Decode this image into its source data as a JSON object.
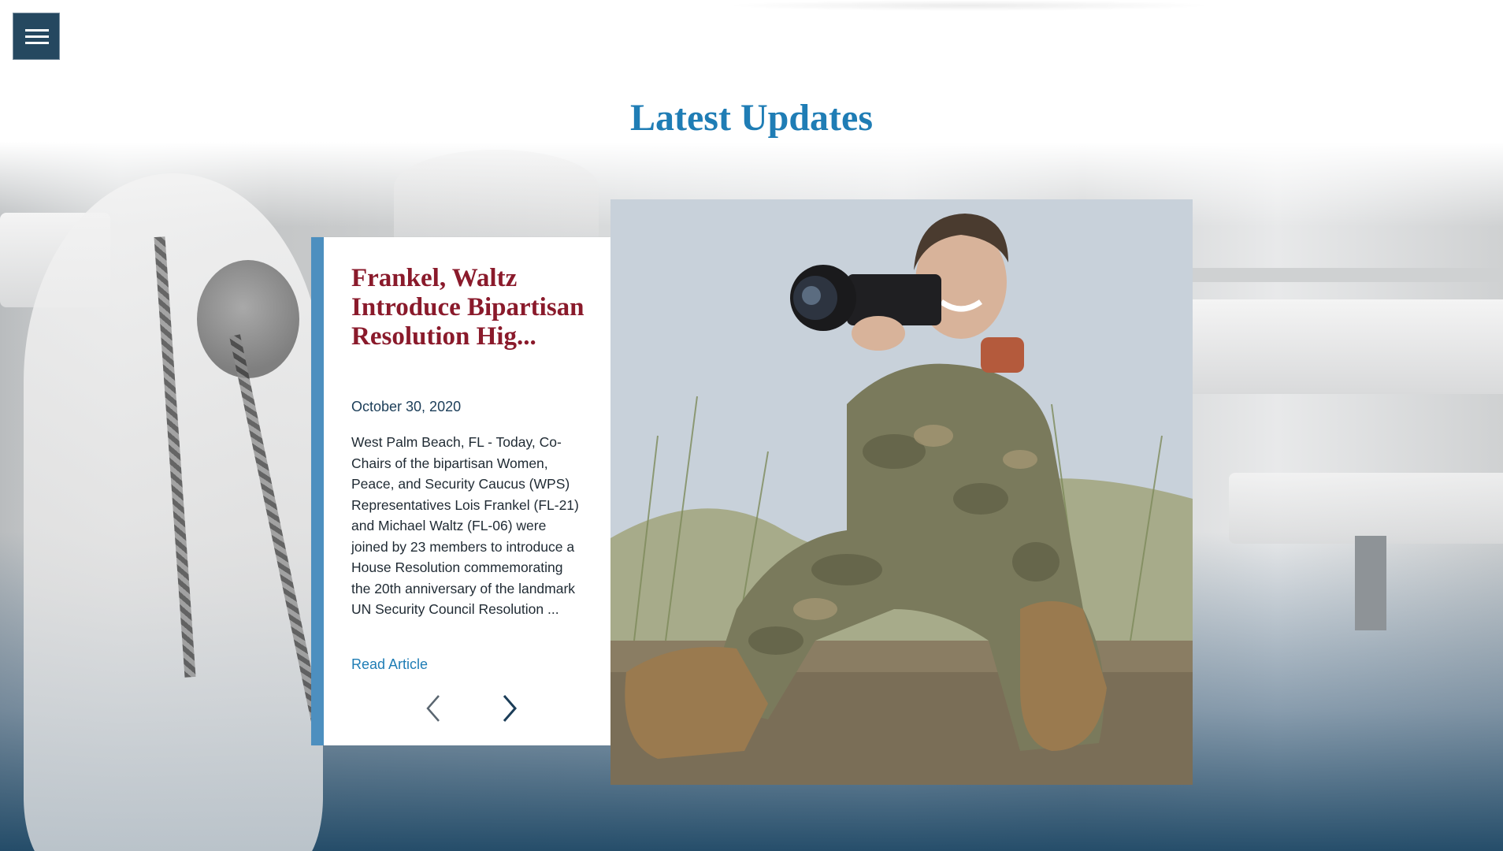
{
  "header": {
    "menu_label": "Menu"
  },
  "section": {
    "title": "Latest Updates"
  },
  "article": {
    "title": "Frankel, Waltz Introduce Bipartisan Resolution Hig...",
    "date": "October 30, 2020",
    "excerpt": "West Palm Beach, FL - Today, Co-Chairs of the bipartisan Women, Peace, and Security Caucus (WPS) Representatives Lois Frankel (FL-21) and Michael Waltz (FL-06) were joined by 23 members to introduce a House Resolution commemorating the 20th anniversary of the landmark UN Security Council Resolution ...",
    "link_label": "Read Article",
    "image_alt": "Service member in camouflage uniform smiling and holding a camera"
  },
  "carousel": {
    "prev_icon": "chevron-left-icon",
    "next_icon": "chevron-right-icon"
  },
  "colors": {
    "title_blue": "#1f7db5",
    "article_title": "#8a1a2b",
    "menu_bg": "#254860",
    "card_accent": "#4d8fbf",
    "footer_navy": "#1c4664"
  },
  "icons": {
    "menu": "hamburger-menu-icon"
  }
}
